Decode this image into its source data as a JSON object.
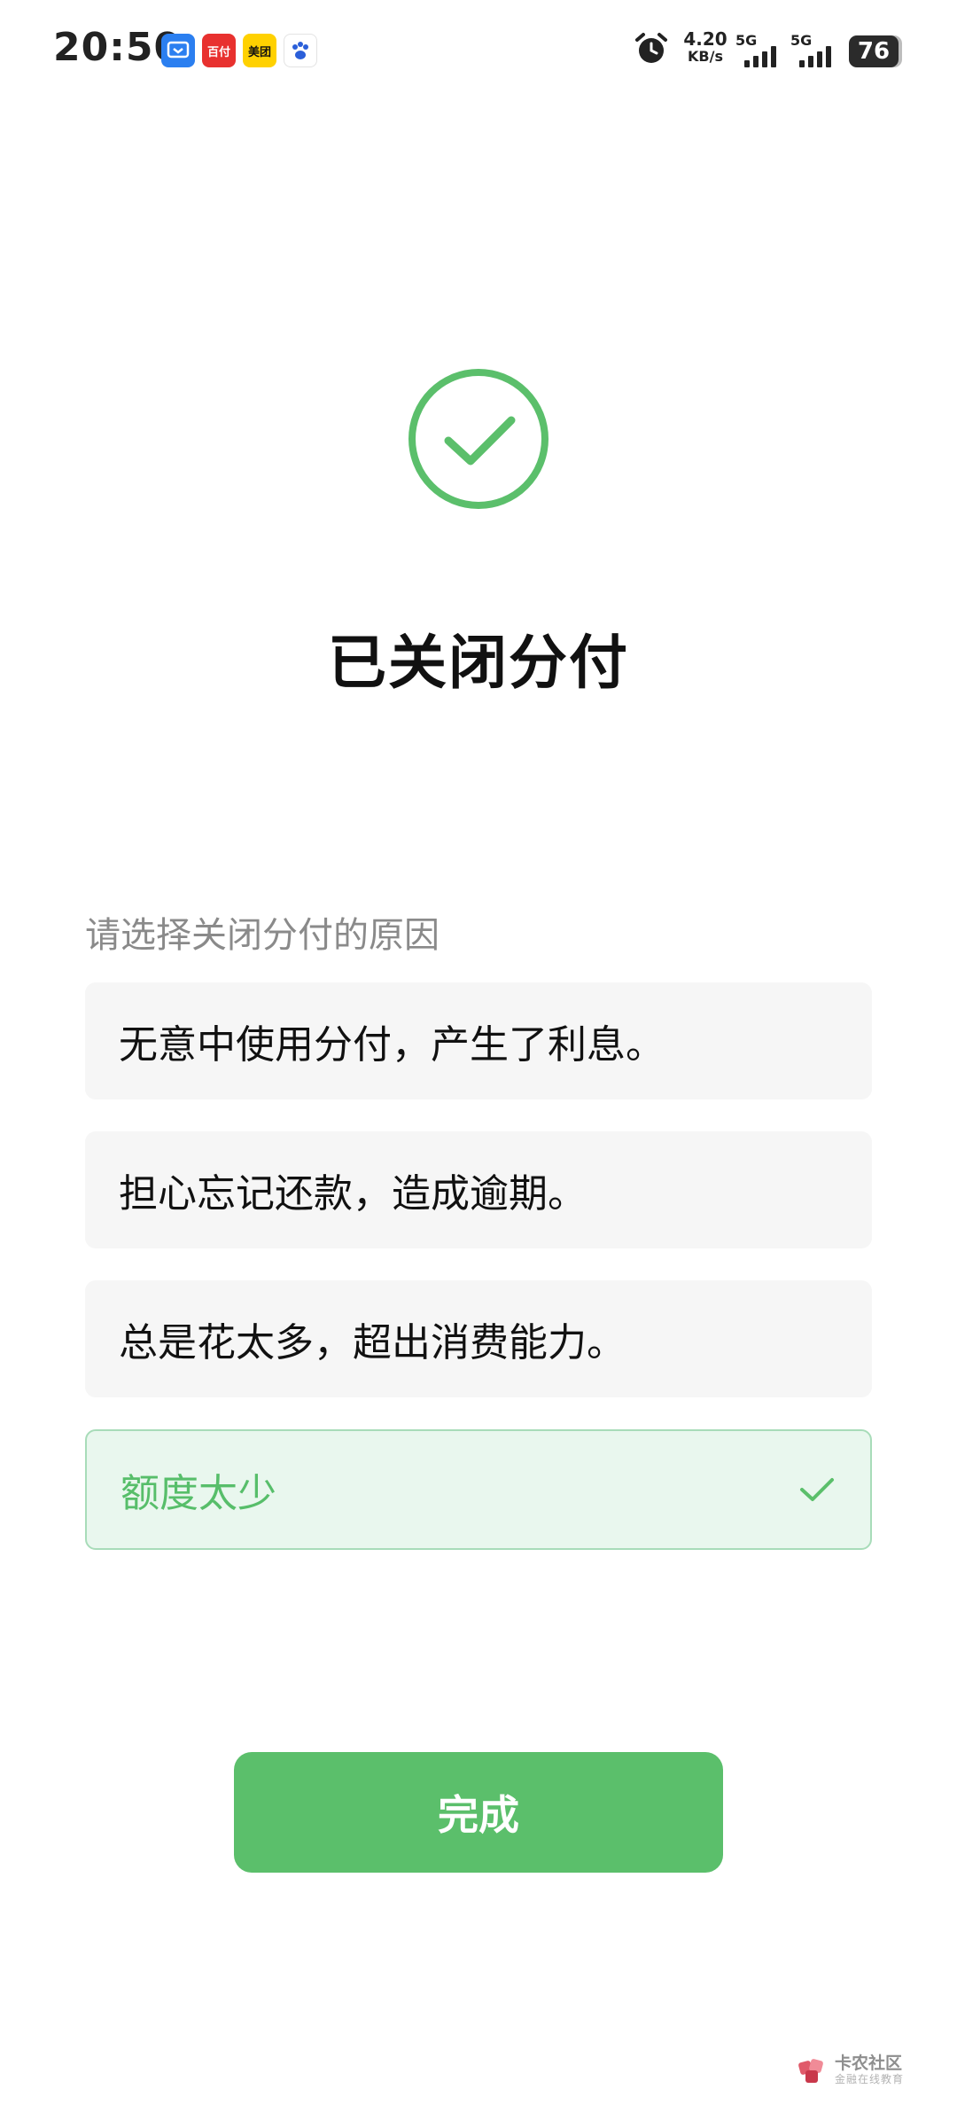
{
  "status_bar": {
    "time": "20:50",
    "apps": [
      {
        "name": "cloud-app-icon",
        "label": "",
        "bg": "#2b7ff0",
        "fg": "#ffffff"
      },
      {
        "name": "pay-app-icon",
        "label": "百付",
        "bg": "#e8312f",
        "fg": "#ffffff"
      },
      {
        "name": "meituan-app-icon",
        "label": "美团",
        "bg": "#ffd100",
        "fg": "#111111"
      },
      {
        "name": "baidu-app-icon",
        "label": "",
        "bg": "#ffffff",
        "fg": "#2b5fd9"
      }
    ],
    "net_speed_value": "4.20",
    "net_speed_unit": "KB/s",
    "signal_1_label": "5G",
    "signal_2_label": "5G",
    "battery": "76"
  },
  "main": {
    "title": "已关闭分付",
    "section_label": "请选择关闭分付的原因",
    "options": [
      {
        "label": "无意中使用分付，产生了利息。",
        "selected": false
      },
      {
        "label": "担心忘记还款，造成逾期。",
        "selected": false
      },
      {
        "label": "总是花太多，超出消费能力。",
        "selected": false
      },
      {
        "label": "额度太少",
        "selected": true
      }
    ],
    "done_button": "完成"
  },
  "watermark": {
    "name": "卡农社区",
    "sub": "金融在线教育"
  },
  "colors": {
    "accent": "#5bbf6b",
    "selected_bg": "#e9f7ee",
    "selected_border": "#a8dcb9"
  }
}
